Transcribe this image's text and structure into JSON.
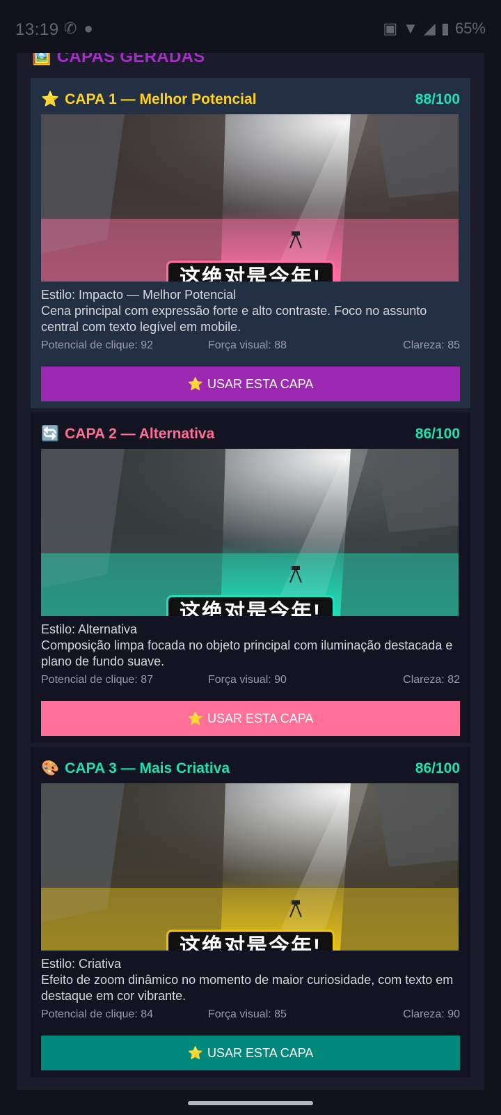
{
  "status_bar": {
    "time": "13:19",
    "battery": "65%"
  },
  "section": {
    "icon": "🖼️",
    "title": "CAPAS GERADAS"
  },
  "cards": [
    {
      "emoji": "⭐",
      "title": "CAPA 1 — Melhor Potencial",
      "title_color": "#ffd21f",
      "score": "88/100",
      "caption": "这绝对是今年!",
      "tint": "#ff6fa3",
      "style_line": "Estilo: Impacto — Melhor Potencial",
      "description": "Cena principal com expressão forte e alto contraste. Foco no assunto central com texto legível em mobile.",
      "metric_click": "Potencial de clique: 92",
      "metric_visual": "Força visual: 88",
      "metric_clarity": "Clareza: 85",
      "button_icon": "⭐",
      "button_label": "USAR ESTA CAPA",
      "button_color": "#9c27b0",
      "card_bg": "#233043"
    },
    {
      "emoji": "🔄",
      "title": "CAPA 2 — Alternativa",
      "title_color": "#ff6f95",
      "score": "86/100",
      "caption": "这绝对是今年!",
      "tint": "#20e0bb",
      "style_line": "Estilo: Alternativa",
      "description": "Composição limpa focada no objeto principal com iluminação destacada e plano de fundo suave.",
      "metric_click": "Potencial de clique: 87",
      "metric_visual": "Força visual: 90",
      "metric_clarity": "Clareza: 82",
      "button_icon": "⭐",
      "button_label": "USAR ESTA CAPA",
      "button_color": "#ff7096",
      "card_bg": "#131421"
    },
    {
      "emoji": "🎨",
      "title": "CAPA 3 — Mais Criativa",
      "title_color": "#1ee0b2",
      "score": "86/100",
      "caption": "这绝对是今年!",
      "tint": "#e6c21a",
      "style_line": "Estilo: Criativa",
      "description": "Efeito de zoom dinâmico no momento de maior curiosidade, com texto em destaque em cor vibrante.",
      "metric_click": "Potencial de clique: 84",
      "metric_visual": "Força visual: 85",
      "metric_clarity": "Clareza: 90",
      "button_icon": "⭐",
      "button_label": "USAR ESTA CAPA",
      "button_color": "#00897b",
      "card_bg": "#131421"
    }
  ]
}
